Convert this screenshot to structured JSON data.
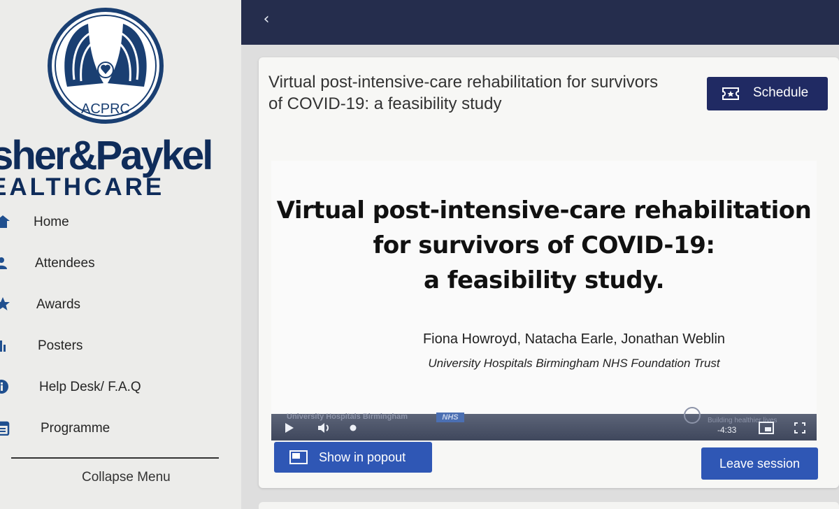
{
  "sidebar": {
    "logo_text": "ACPRC",
    "sponsor_name": "isher&Paykel",
    "sponsor_sub": "EALTHCARE",
    "nav": [
      {
        "label": "Home",
        "icon": "home-icon"
      },
      {
        "label": "Attendees",
        "icon": "people-icon"
      },
      {
        "label": "Awards",
        "icon": "star-icon"
      },
      {
        "label": "Posters",
        "icon": "bar-chart-icon"
      },
      {
        "label": "Help Desk/ F.A.Q",
        "icon": "info-icon"
      },
      {
        "label": "Programme",
        "icon": "calendar-icon"
      }
    ],
    "collapse_label": "Collapse Menu"
  },
  "header": {
    "back_glyph": "‹"
  },
  "session": {
    "title": "Virtual post-intensive-care rehabilitation for survivors of COVID-19: a feasibility study",
    "schedule_label": "Schedule"
  },
  "slide": {
    "title_lines": [
      "Virtual post-intensive-care rehabilitation",
      "for survivors of COVID-19:",
      "a feasibility study."
    ],
    "authors": "Fiona Howroyd, Natacha Earle, Jonathan Weblin",
    "affiliation": "University Hospitals Birmingham NHS Foundation Trust",
    "footer_org": "University Hospitals Birmingham",
    "footer_nhs": "NHS",
    "footer_tagline": "Building healthier lives"
  },
  "player": {
    "time_remaining": "-4:33"
  },
  "actions": {
    "popout_label": "Show in popout",
    "leave_label": "Leave session"
  },
  "colors": {
    "topbar": "#252d4d",
    "primary_button": "#2f57b5",
    "schedule_button": "#202a63",
    "brand_navy": "#0f2c5a"
  }
}
